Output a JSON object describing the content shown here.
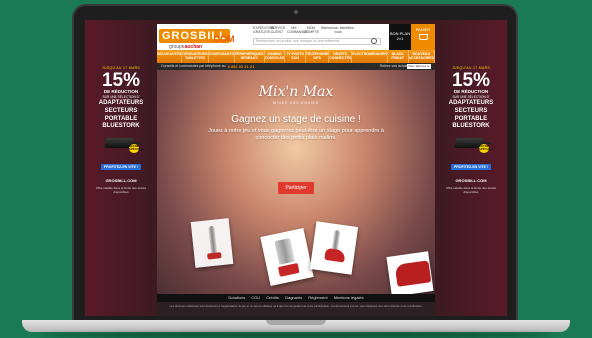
{
  "header": {
    "logo_main": "GROSBILL",
    "logo_dotcom": ".COM",
    "logo_sub_prefix": "groupe",
    "logo_sub_brand": "auchan",
    "top_links": [
      "EXPÉDITION GRATUITE",
      "SERVICE CLIENT",
      "MA COMMANDE",
      "MON COMPTE",
      "Bienvenue, identifiez-vous"
    ],
    "search_placeholder": "Recherchez un produit, une marque ou une référence",
    "black_promo": "BON PLAN 2×1",
    "cart_label": "PANIER"
  },
  "nav": {
    "items": [
      "NOUVEAUTÉS",
      "ORDINATEURS TABLETTES",
      "COMPOSANTS",
      "PÉRIPHÉRIQUES RÉSEAUX",
      "GAMING CONSOLES",
      "TV PHOTO SON",
      "TÉLÉPHONIE GPS",
      "OBJETS CONNECTÉS",
      "ÉLECTROMÉNAGER",
      "BLACK FRIDAY",
      "NOUVEAU ACCESSOIRES"
    ]
  },
  "info_bar": {
    "text": "Conseils et commandes par téléphone au",
    "phone": "0 892 02 21 21",
    "right_text": "Retirez vos achats à la",
    "select_label": "Votre adresse e-mail"
  },
  "side_banner": {
    "date": "JUSQU'AU 17 MARS",
    "percent": "15%",
    "reduction": "DE RÉDUCTION",
    "small": "SUR UNE SÉLECTION D'",
    "line1": "ADAPTATEURS",
    "line2": "SECTEURS",
    "line3": "PORTABLE",
    "brand": "BLUESTORK",
    "badge": "OFFRE SPÉCIALE",
    "cta": "PROFITEZ-EN VITE !",
    "footer_logo": "GROSBILL.COM",
    "footer_note": "Offre valable dans la limite des stocks disponibles"
  },
  "center": {
    "brand": "Mix'n Max",
    "brand_sub": "MIXEZ VOS ENVIES",
    "headline": "Gagnez un stage de cuisine !",
    "subtext": "Jouez à notre jeu et vous gagnerez peut-être un stage pour apprendre à concocter des petits plats malins.",
    "cta_label": "Participer"
  },
  "footer": {
    "links": [
      "Dotations",
      "CGU",
      "Crédits",
      "Gagnants",
      "Règlement",
      "Mentions légales"
    ],
    "note": "Les données collectées sont destinées à l'organisateur du jeu et ne seront utilisées qu'à des fins de gestion de votre participation. Conformément à la loi, vous disposez d'un droit d'accès et de rectification."
  },
  "colors": {
    "page_bg": "#1a7a55",
    "brand_orange": "#f08a00",
    "cta_red": "#e03a2e",
    "side_bg": "#5a1a2a"
  }
}
